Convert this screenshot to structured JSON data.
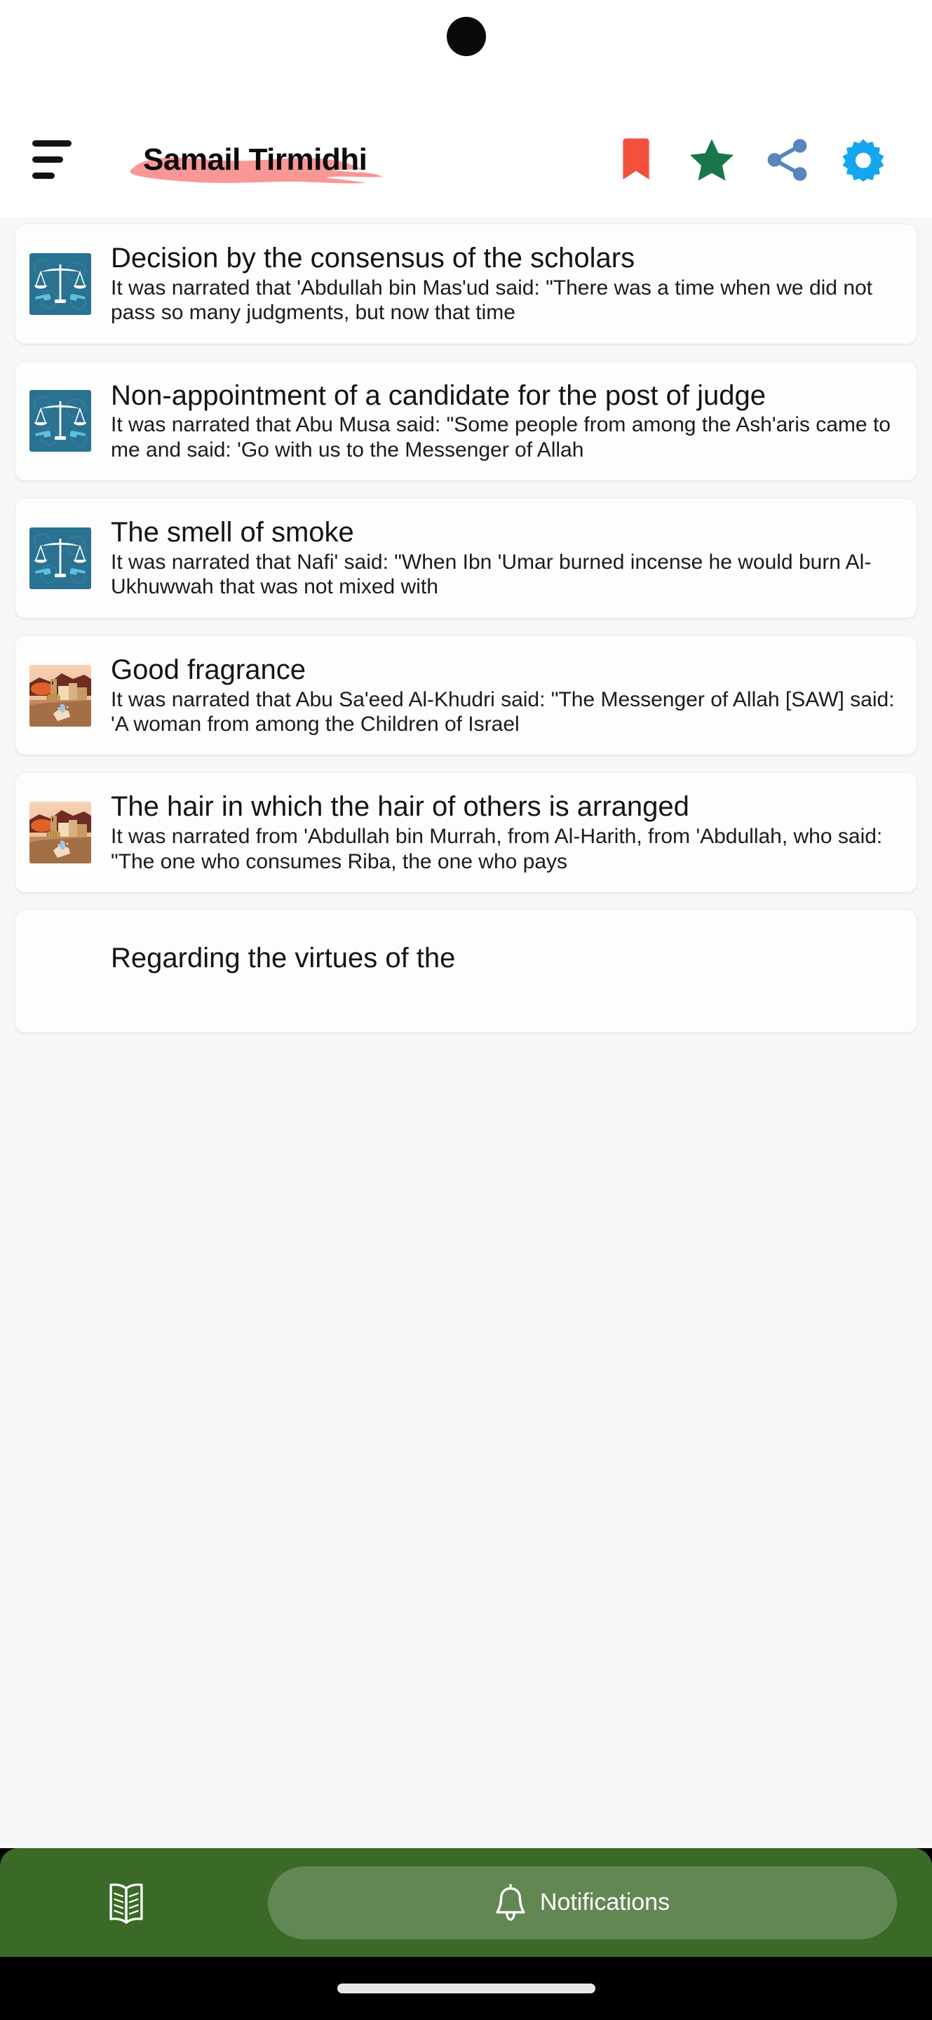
{
  "app": {
    "title": "Samail Tirmidhi",
    "title_highlight_color": "#f98e8e",
    "menu_icon": "hamburger-menu-icon"
  },
  "appbar": {
    "actions": [
      {
        "name": "bookmark-icon",
        "label": "Bookmark",
        "color": "#f4503e"
      },
      {
        "name": "star-icon",
        "label": "Favorite",
        "color": "#17774b"
      },
      {
        "name": "share-icon",
        "label": "Share",
        "color": "#5587bb"
      },
      {
        "name": "gear-icon",
        "label": "Settings",
        "color": "#14a6ee"
      }
    ]
  },
  "list": {
    "items": [
      {
        "thumb": "scales-of-justice-icon",
        "thumb_bg": "#2a7291",
        "title": "Decision by the consensus of the scholars",
        "desc": "It was narrated that 'Abdullah bin Mas'ud said: \"There was a time when we did not pass so many judgments, but now that time"
      },
      {
        "thumb": "scales-of-justice-icon",
        "thumb_bg": "#2a7291",
        "title": "Non-appointment of a candidate for the post of judge",
        "desc": "It was narrated that Abu Musa said: \"Some people from among the Ash'aris came to me and said: 'Go with us to the Messenger of Allah"
      },
      {
        "thumb": "scales-of-justice-icon",
        "thumb_bg": "#2a7291",
        "title": "The smell of smoke",
        "desc": "It was narrated that Nafi' said: \"When Ibn 'Umar burned incense he would burn Al-Ukhuwwah that was not mixed with"
      },
      {
        "thumb": "desert-city-icon",
        "thumb_bg": "#e3a678",
        "title": "Good fragrance",
        "desc": "It was narrated that Abu Sa'eed Al-Khudri said: \"The Messenger of Allah [SAW] said: 'A woman from among the Children of Israel"
      },
      {
        "thumb": "desert-city-icon",
        "thumb_bg": "#e3a678",
        "title": "The hair in which the hair of others is arranged",
        "desc": "It was narrated from 'Abdullah bin Murrah, from Al-Harith, from 'Abdullah, who said: \"The one who consumes Riba, the one who pays"
      },
      {
        "thumb": "",
        "thumb_bg": "",
        "title": "Regarding the virtues of the",
        "desc": ""
      }
    ]
  },
  "bottomnav": {
    "background_color": "#3b6a28",
    "book_icon": "open-book-icon",
    "notifications": {
      "icon": "bell-icon",
      "label": "Notifications"
    }
  }
}
